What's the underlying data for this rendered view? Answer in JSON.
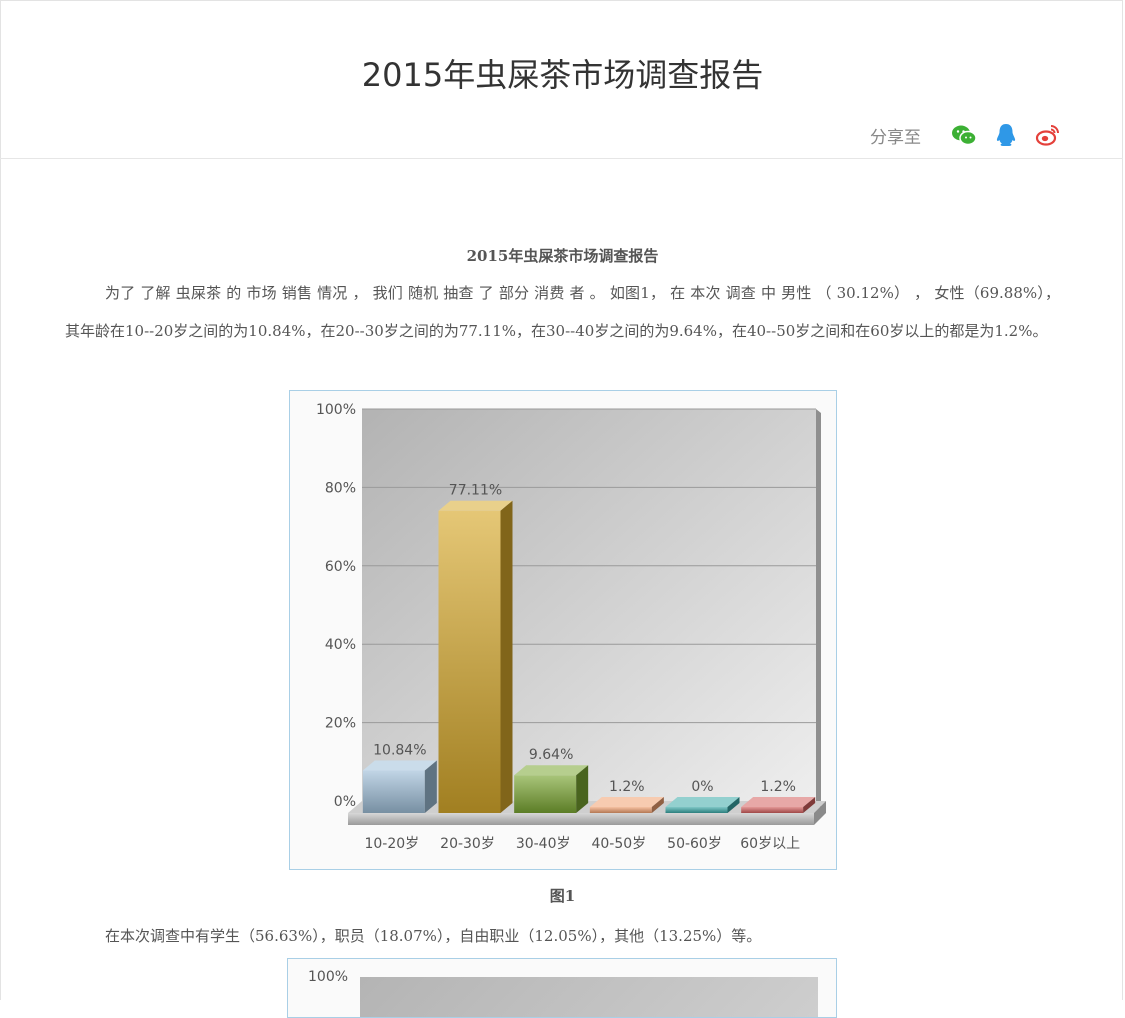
{
  "page": {
    "title": "2015年虫屎茶市场调查报告",
    "share_label": "分享至",
    "share_icons": [
      "wechat-icon",
      "qq-icon",
      "weibo-icon"
    ]
  },
  "article": {
    "heading": "2015年虫屎茶市场调查报告",
    "paragraph1": "为了 了解 虫屎茶 的 市场 销售 情况 ， 我们 随机 抽查 了 部分 消费 者 。 如图1， 在 本次 调查 中 男性 （ 30.12%） ， 女性（69.88%），其年龄在10--20岁之间的为10.84%，在20--30岁之间的为77.11%，在30--40岁之间的为9.64%，在40--50岁之间和在60岁以上的都是为1.2%。",
    "figure1_caption": "图1",
    "paragraph2": "在本次调查中有学生（56.63%），职员（18.07%），自由职业（12.05%），其他（13.25%）等。"
  },
  "chart_data": [
    {
      "type": "bar",
      "categories": [
        "10-20岁",
        "20-30岁",
        "30-40岁",
        "40-50岁",
        "50-60岁",
        "60岁以上"
      ],
      "values": [
        10.84,
        77.11,
        9.64,
        1.2,
        0,
        1.2
      ],
      "value_labels": [
        "10.84%",
        "77.11%",
        "9.64%",
        "1.2%",
        "0%",
        "1.2%"
      ],
      "yticks": [
        "0%",
        "20%",
        "40%",
        "60%",
        "80%",
        "100%"
      ],
      "ylim": [
        0,
        100
      ],
      "grid": true,
      "colors": [
        "#9fbfd8",
        "#d7a92c",
        "#7aa632",
        "#f0a070",
        "#3aa9a8",
        "#d4605f"
      ]
    },
    {
      "type": "bar",
      "yticks": [
        "100%"
      ]
    }
  ]
}
